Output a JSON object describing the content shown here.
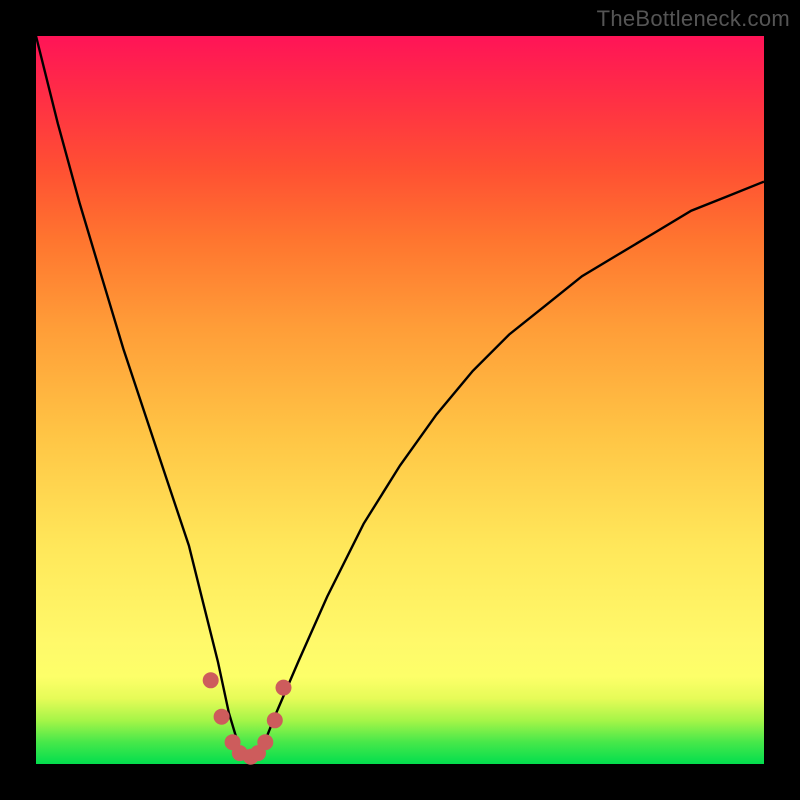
{
  "watermark": "TheBottleneck.com",
  "chart_data": {
    "type": "line",
    "title": "",
    "xlabel": "",
    "ylabel": "",
    "xlim": [
      0,
      100
    ],
    "ylim": [
      0,
      100
    ],
    "grid": false,
    "legend": false,
    "note": "Values read off pixel positions; axes unlabeled; y is percentage-like (0=green bottom, 100=red top).",
    "series": [
      {
        "name": "bottleneck-curve",
        "x": [
          0,
          3,
          6,
          9,
          12,
          15,
          18,
          21,
          23,
          25,
          26.5,
          28,
          29.5,
          31,
          33,
          36,
          40,
          45,
          50,
          55,
          60,
          65,
          70,
          75,
          80,
          85,
          90,
          95,
          100
        ],
        "values": [
          100,
          88,
          77,
          67,
          57,
          48,
          39,
          30,
          22,
          14,
          7,
          2,
          0,
          2,
          7,
          14,
          23,
          33,
          41,
          48,
          54,
          59,
          63,
          67,
          70,
          73,
          76,
          78,
          80
        ]
      },
      {
        "name": "marker-dots",
        "x": [
          24.0,
          25.5,
          27.0,
          28.0,
          29.5,
          30.5,
          31.5,
          32.8,
          34.0
        ],
        "values": [
          11.5,
          6.5,
          3.0,
          1.5,
          1.0,
          1.5,
          3.0,
          6.0,
          10.5
        ]
      }
    ],
    "colors": {
      "curve": "#000000",
      "markers": "#cd5c5c"
    }
  }
}
